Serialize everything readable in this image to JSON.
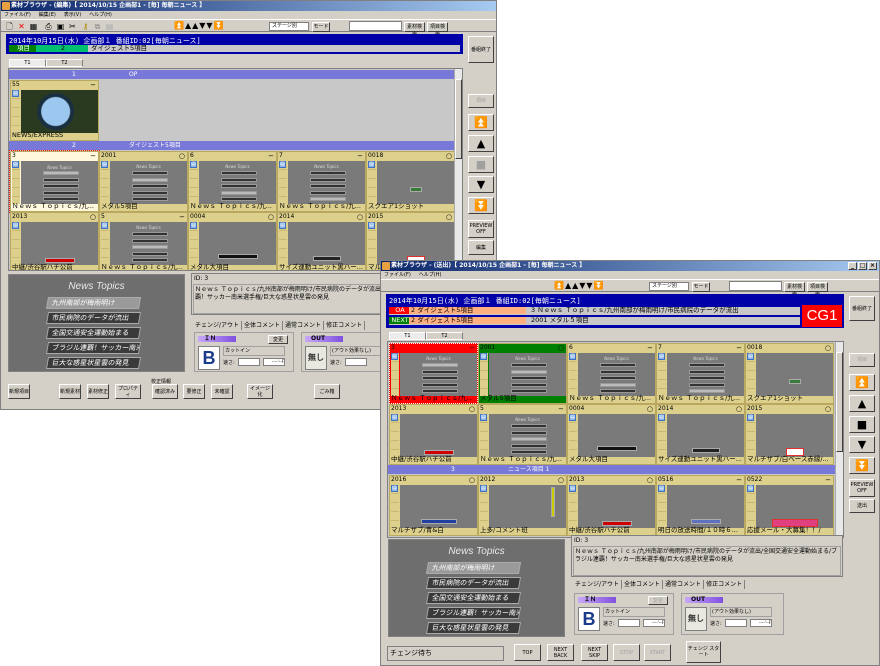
{
  "back_window": {
    "title": "素材ブラウザ - (編集)【 2014/10/15 企画部1 - [毎] 毎朝ニュース 】",
    "menu": [
      "ファイル(F)",
      "編集(E)",
      "表示(V)",
      "ヘルプ(H)"
    ],
    "toolbar": {
      "nav_arrows": "⏫▲▲▼▼⏬",
      "stage_select": "ステージ別",
      "mode_label": "モード",
      "search_value": "",
      "material_search": "素材検索",
      "item_search": "項目検索"
    },
    "header": {
      "date_line": "2014年10月15日(水) 企画部１ 番組ID:02[毎朝ニュース]",
      "item_label": "項目",
      "item_number": "2",
      "item_name": "ダイジェスト5項目"
    },
    "tabs": [
      "T1",
      "T2"
    ],
    "groups": [
      {
        "number": "1",
        "name": "OP",
        "cells": [
          {
            "id": "55",
            "mark": "−",
            "title": "NEWS/EXPRESS",
            "thumb": "logo"
          }
        ]
      },
      {
        "number": "2",
        "name": "ダイジェスト5項目",
        "cells": [
          {
            "id": "3",
            "mark": "−",
            "title": "Ｎｅｗｓ Ｔｏｐｉｃｓ/九...",
            "thumb": "topics",
            "hl": 0,
            "state": "sel"
          },
          {
            "id": "2001",
            "mark": "○",
            "title": "メタル5項目",
            "thumb": "topics",
            "hl": 1
          },
          {
            "id": "6",
            "mark": "−",
            "title": "Ｎｅｗｓ Ｔｏｐｉｃｓ/九...",
            "thumb": "topics",
            "hl": 3
          },
          {
            "id": "7",
            "mark": "−",
            "title": "Ｎｅｗｓ Ｔｏｐｉｃｓ/九...",
            "thumb": "topics",
            "hl": 4
          },
          {
            "id": "0018",
            "mark": "○",
            "title": "スクエア1ショット",
            "thumb": "square"
          },
          {
            "id": "2013",
            "mark": "○",
            "title": "中継/渋谷駅ハチ公前",
            "thumb": "live"
          },
          {
            "id": "5",
            "mark": "−",
            "title": "Ｎｅｗｓ Ｔｏｐｉｃｓ/九...",
            "thumb": "topics",
            "hl": 2
          },
          {
            "id": "0004",
            "mark": "○",
            "title": "メタル大項目",
            "thumb": "metal"
          },
          {
            "id": "2014",
            "mark": "○",
            "title": "サイズ連動ユニット黒ハー...",
            "thumb": "unit"
          },
          {
            "id": "2015",
            "mark": "○",
            "title": "マルチザブ/白ベース赤縁/...",
            "thumb": "multi"
          }
        ]
      }
    ],
    "right_buttons": {
      "end_program": "番組終了",
      "item": "項目",
      "preview_off": "PREVIEW OFF",
      "edit": "編集"
    },
    "info": {
      "id": "ID: 3",
      "text": "Ｎｅｗｓ Ｔｏｐｉｃｓ/九州南部が梅雨明け/市民病院のデータが流出/全国交通安全運動始まる/ブラジル連覇！サッカー南米選手権/巨大な惑星状星雲の発見"
    },
    "content_tabs": [
      "チェンジ/アウト",
      "全体コメント",
      "通常コメント",
      "修正コメント"
    ],
    "in_panel": {
      "label": "ＩＮ",
      "change": "変更",
      "effect_icon": "B",
      "effect": "カットイン",
      "speed_label": "速さ:",
      "frames": "----'--F"
    },
    "out_panel": {
      "label": "OUT",
      "effect_icon": "無し",
      "effect": "(アウト効果なし)",
      "speed_label": "速さ:",
      "frames": "----'--F"
    },
    "correction_group": "校正情報",
    "bottom_buttons": [
      "新規項目",
      "新規素材",
      "素材修正",
      "プロパティ",
      "確認済み",
      "要修正",
      "未確認",
      "イメージ化",
      "ごみ箱"
    ]
  },
  "front_window": {
    "title": "素材ブラウザ - (送出)【 2014/10/15 企画部1 - [毎] 毎朝ニュース 】",
    "menu": [
      "ファイル(F)",
      "ヘルプ(H)"
    ],
    "toolbar": {
      "nav_arrows": "⏫▲▲▼▼⏬",
      "stage_select": "ステージ別",
      "mode_label": "モード",
      "search_value": "",
      "material_search": "素材検索",
      "item_search": "項目検索"
    },
    "header": {
      "date_line": "2014年10月15日(水) 企画部１ 番組ID:02[毎朝ニュース]",
      "oa_label": "OA",
      "oa_item": "2 ダイジェスト5項目",
      "oa_material": "3 Ｎｅｗｓ Ｔｏｐｉｃｓ/九州南部が梅雨明け/市民病院のデータが流出",
      "next_label": "NEXT",
      "next_item": "2 ダイジェスト5項目",
      "next_material": "2001 メタル５項目",
      "channel": "CG1"
    },
    "tabs": [
      "T1",
      "T2"
    ],
    "groups": [
      {
        "number": "",
        "name": "",
        "cells": [
          {
            "id": "3",
            "mark": "−",
            "title": "Ｎｅｗｓ Ｔｏｐｉｃｓ/九...",
            "thumb": "topics",
            "hl": 0,
            "state": "oa"
          },
          {
            "id": "2001",
            "mark": "○",
            "title": "メタル5項目",
            "thumb": "topics",
            "hl": 1,
            "state": "next"
          },
          {
            "id": "6",
            "mark": "−",
            "title": "Ｎｅｗｓ Ｔｏｐｉｃｓ/九...",
            "thumb": "topics",
            "hl": 3
          },
          {
            "id": "7",
            "mark": "−",
            "title": "Ｎｅｗｓ Ｔｏｐｉｃｓ/九...",
            "thumb": "topics",
            "hl": 4
          },
          {
            "id": "0018",
            "mark": "○",
            "title": "スクエア1ショット",
            "thumb": "square"
          },
          {
            "id": "2013",
            "mark": "○",
            "title": "中継/渋谷駅ハチ公前",
            "thumb": "live"
          },
          {
            "id": "5",
            "mark": "−",
            "title": "Ｎｅｗｓ Ｔｏｐｉｃｓ/九...",
            "thumb": "topics",
            "hl": 2
          },
          {
            "id": "0004",
            "mark": "○",
            "title": "メタル大項目",
            "thumb": "metal"
          },
          {
            "id": "2014",
            "mark": "○",
            "title": "サイズ連動ユニット黒ハー...",
            "thumb": "unit"
          },
          {
            "id": "2015",
            "mark": "○",
            "title": "マルチザブ/白ベース赤縁/...",
            "thumb": "multi"
          }
        ]
      },
      {
        "number": "3",
        "name": "ニュース項目 1",
        "cells": [
          {
            "id": "2016",
            "mark": "○",
            "title": "マルチザブ/青&白",
            "thumb": "blue"
          },
          {
            "id": "2012",
            "mark": "○",
            "title": "上多/コメント班",
            "thumb": "vertical"
          },
          {
            "id": "2013",
            "mark": "○",
            "title": "中継/渋谷駅ハチ公前",
            "thumb": "live"
          },
          {
            "id": "0516",
            "mark": "−",
            "title": "明日の放送時間/１０時６...",
            "thumb": "time"
          },
          {
            "id": "0522",
            "mark": "−",
            "title": "応援メール・大募集！！/",
            "thumb": "mail"
          }
        ]
      }
    ],
    "right_buttons": {
      "end_program": "番組終了",
      "item": "項目",
      "preview_off": "PREVIEW OFF",
      "send": "送出"
    },
    "info": {
      "id": "ID: 3",
      "text": "Ｎｅｗｓ Ｔｏｐｉｃｓ/九州南部が梅雨明け/市民病院のデータが流出/全国交通安全運動始まる/ブラジル連覇！サッカー南米選手権/巨大な惑星状星雲の発見"
    },
    "content_tabs": [
      "チェンジ/アウト",
      "全体コメント",
      "通常コメント",
      "修正コメント"
    ],
    "in_panel": {
      "label": "ＩＮ",
      "change": "変更",
      "effect_icon": "B",
      "effect": "カットイン",
      "speed_label": "速さ:",
      "frames": "----'--F"
    },
    "out_panel": {
      "label": "OUT",
      "effect_icon": "無し",
      "effect": "(アウト効果なし)",
      "speed_label": "速さ:",
      "frames": "----'--F"
    },
    "status": "チェンジ待ち",
    "bottom_buttons": [
      "TOP",
      "NEXT BACK",
      "NEXT SKIP",
      "STOP",
      "START",
      "チェンジ スタート"
    ]
  },
  "preview": {
    "title": "News Topics",
    "items": [
      "九州南部が梅雨明け",
      "市民病院のデータが流出",
      "全国交通安全運動始まる",
      "ブラジル連覇！サッカー南米選手権",
      "巨大な惑星状星雲の発見"
    ],
    "highlighted": 0
  },
  "colors": {
    "header_bg": "#0000a8",
    "oa": "#ff0000",
    "next": "#008000",
    "item_green": "#00c070",
    "group_bar": "#7878d8",
    "cell": "#ddd08c",
    "channel": "#ff0000"
  }
}
